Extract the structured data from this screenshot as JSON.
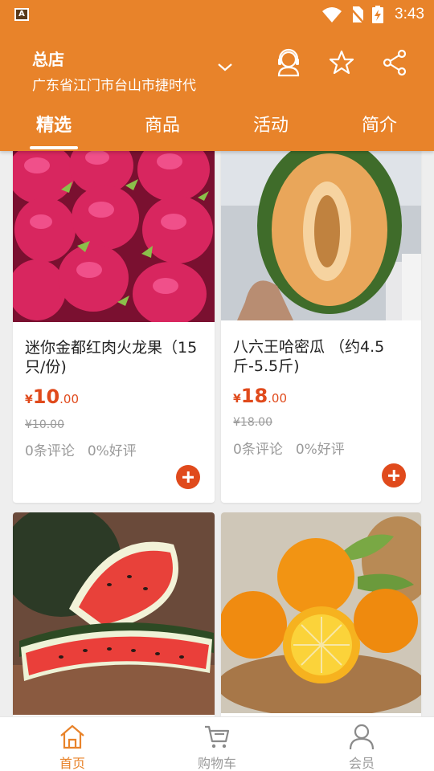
{
  "status_bar": {
    "time": "3:43",
    "app_badge": "A"
  },
  "header": {
    "store_name": "总店",
    "address": "广东省江门市台山市捷时代",
    "icons": [
      "chevron-down-icon",
      "customer-service-icon",
      "star-icon",
      "share-icon"
    ]
  },
  "tabs": [
    {
      "label": "精选",
      "active": true
    },
    {
      "label": "商品",
      "active": false
    },
    {
      "label": "活动",
      "active": false
    },
    {
      "label": "简介",
      "active": false
    }
  ],
  "products": [
    {
      "name": "迷你金都红肉火龙果（15只/份)",
      "currency": "¥",
      "price_int": "10",
      "price_dec": ".00",
      "old_price": "¥10.00",
      "reviews": "0条评论",
      "rating": "0%好评",
      "image": "dragon-fruit"
    },
    {
      "name": "八六王哈密瓜 （约4.5斤-5.5斤)",
      "currency": "¥",
      "price_int": "18",
      "price_dec": ".00",
      "old_price": "¥18.00",
      "reviews": "0条评论",
      "rating": "0%好评",
      "image": "hami-melon"
    },
    {
      "image": "watermelon"
    },
    {
      "image": "oranges"
    }
  ],
  "bottom_nav": [
    {
      "label": "首页",
      "icon": "home-icon",
      "active": true
    },
    {
      "label": "购物车",
      "icon": "cart-icon",
      "active": false
    },
    {
      "label": "会员",
      "icon": "user-icon",
      "active": false
    }
  ],
  "colors": {
    "brand": "#e8832a",
    "price": "#e04a1c",
    "muted": "#9a9a9a"
  }
}
